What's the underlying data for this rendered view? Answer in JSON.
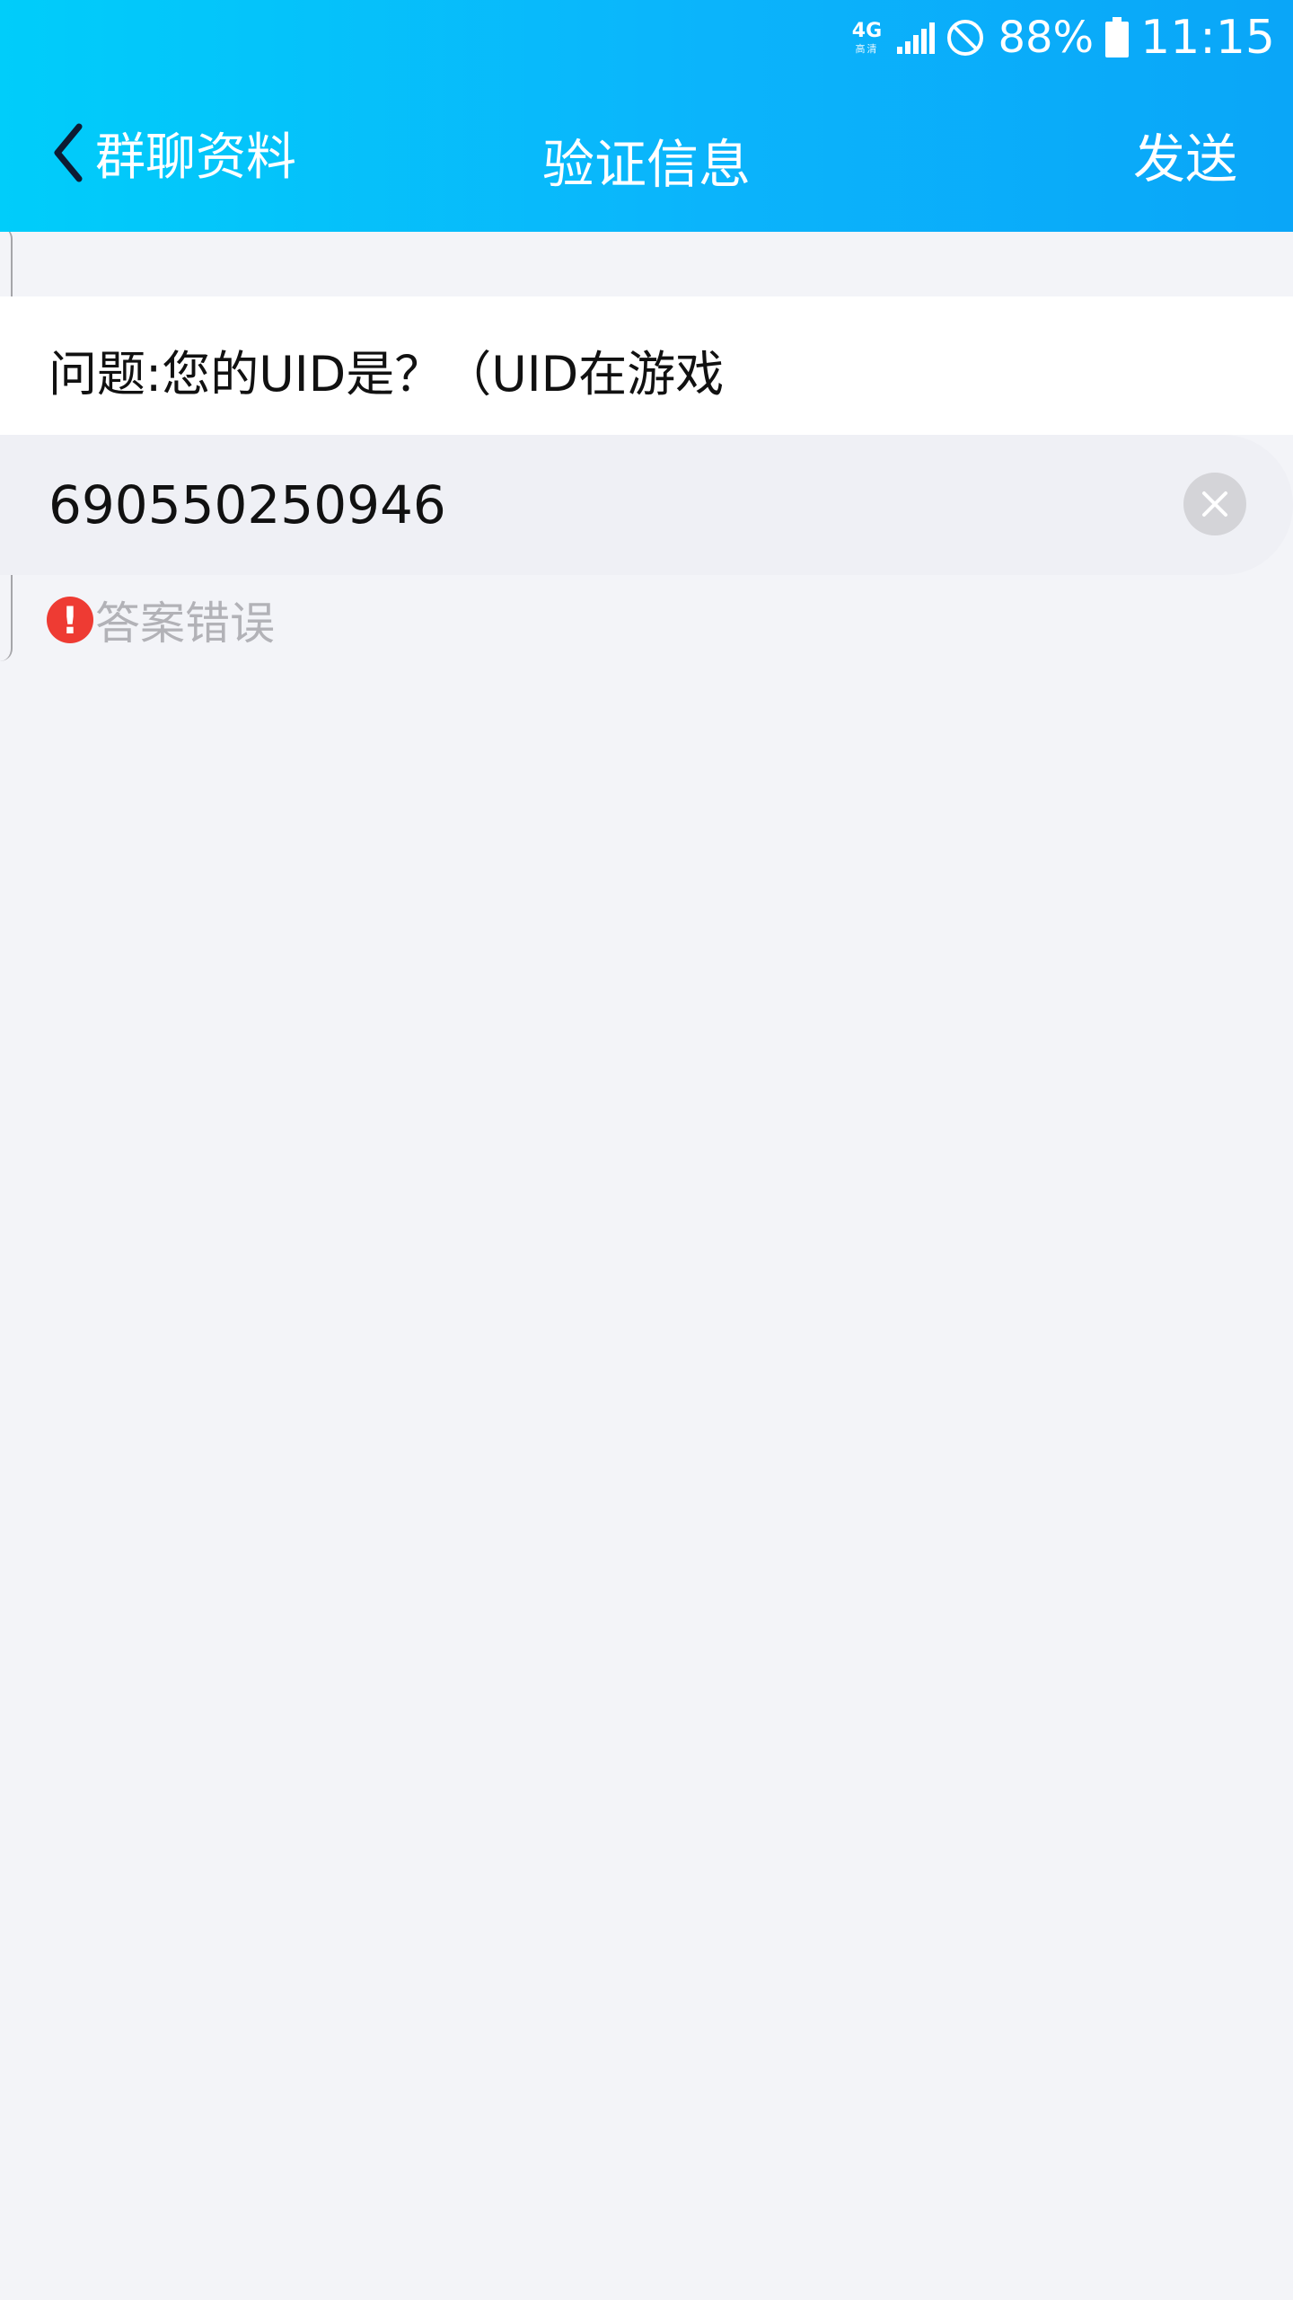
{
  "status_bar": {
    "network_type": "4G",
    "network_sub": "高清",
    "battery_percent": "88%",
    "time": "11:15",
    "icons": [
      "network-4g-icon",
      "signal-icon",
      "do-not-disturb-icon",
      "battery-icon"
    ]
  },
  "nav": {
    "back_label": "群聊资料",
    "title": "验证信息",
    "send_label": "发送"
  },
  "question": {
    "text": "问题:您的UID是？（UID在游戏"
  },
  "answer": {
    "value": "690550250946",
    "clear_icon": "clear-icon"
  },
  "error": {
    "icon": "!",
    "text": "答案错误"
  },
  "colors": {
    "header_gradient_start": "#00cdfa",
    "header_gradient_end": "#0aa6f8",
    "background": "#f3f4f8",
    "error_red": "#ee3b33",
    "error_text": "#b2b2b7"
  }
}
